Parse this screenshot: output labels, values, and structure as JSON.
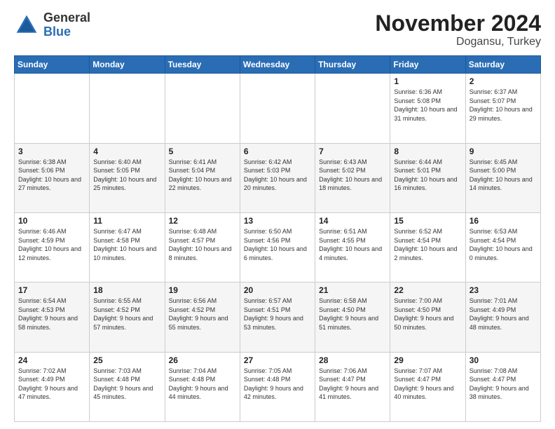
{
  "logo": {
    "general": "General",
    "blue": "Blue"
  },
  "title": "November 2024",
  "subtitle": "Dogansu, Turkey",
  "days_of_week": [
    "Sunday",
    "Monday",
    "Tuesday",
    "Wednesday",
    "Thursday",
    "Friday",
    "Saturday"
  ],
  "weeks": [
    [
      {
        "day": "",
        "info": ""
      },
      {
        "day": "",
        "info": ""
      },
      {
        "day": "",
        "info": ""
      },
      {
        "day": "",
        "info": ""
      },
      {
        "day": "",
        "info": ""
      },
      {
        "day": "1",
        "info": "Sunrise: 6:36 AM\nSunset: 5:08 PM\nDaylight: 10 hours and 31 minutes."
      },
      {
        "day": "2",
        "info": "Sunrise: 6:37 AM\nSunset: 5:07 PM\nDaylight: 10 hours and 29 minutes."
      }
    ],
    [
      {
        "day": "3",
        "info": "Sunrise: 6:38 AM\nSunset: 5:06 PM\nDaylight: 10 hours and 27 minutes."
      },
      {
        "day": "4",
        "info": "Sunrise: 6:40 AM\nSunset: 5:05 PM\nDaylight: 10 hours and 25 minutes."
      },
      {
        "day": "5",
        "info": "Sunrise: 6:41 AM\nSunset: 5:04 PM\nDaylight: 10 hours and 22 minutes."
      },
      {
        "day": "6",
        "info": "Sunrise: 6:42 AM\nSunset: 5:03 PM\nDaylight: 10 hours and 20 minutes."
      },
      {
        "day": "7",
        "info": "Sunrise: 6:43 AM\nSunset: 5:02 PM\nDaylight: 10 hours and 18 minutes."
      },
      {
        "day": "8",
        "info": "Sunrise: 6:44 AM\nSunset: 5:01 PM\nDaylight: 10 hours and 16 minutes."
      },
      {
        "day": "9",
        "info": "Sunrise: 6:45 AM\nSunset: 5:00 PM\nDaylight: 10 hours and 14 minutes."
      }
    ],
    [
      {
        "day": "10",
        "info": "Sunrise: 6:46 AM\nSunset: 4:59 PM\nDaylight: 10 hours and 12 minutes."
      },
      {
        "day": "11",
        "info": "Sunrise: 6:47 AM\nSunset: 4:58 PM\nDaylight: 10 hours and 10 minutes."
      },
      {
        "day": "12",
        "info": "Sunrise: 6:48 AM\nSunset: 4:57 PM\nDaylight: 10 hours and 8 minutes."
      },
      {
        "day": "13",
        "info": "Sunrise: 6:50 AM\nSunset: 4:56 PM\nDaylight: 10 hours and 6 minutes."
      },
      {
        "day": "14",
        "info": "Sunrise: 6:51 AM\nSunset: 4:55 PM\nDaylight: 10 hours and 4 minutes."
      },
      {
        "day": "15",
        "info": "Sunrise: 6:52 AM\nSunset: 4:54 PM\nDaylight: 10 hours and 2 minutes."
      },
      {
        "day": "16",
        "info": "Sunrise: 6:53 AM\nSunset: 4:54 PM\nDaylight: 10 hours and 0 minutes."
      }
    ],
    [
      {
        "day": "17",
        "info": "Sunrise: 6:54 AM\nSunset: 4:53 PM\nDaylight: 9 hours and 58 minutes."
      },
      {
        "day": "18",
        "info": "Sunrise: 6:55 AM\nSunset: 4:52 PM\nDaylight: 9 hours and 57 minutes."
      },
      {
        "day": "19",
        "info": "Sunrise: 6:56 AM\nSunset: 4:52 PM\nDaylight: 9 hours and 55 minutes."
      },
      {
        "day": "20",
        "info": "Sunrise: 6:57 AM\nSunset: 4:51 PM\nDaylight: 9 hours and 53 minutes."
      },
      {
        "day": "21",
        "info": "Sunrise: 6:58 AM\nSunset: 4:50 PM\nDaylight: 9 hours and 51 minutes."
      },
      {
        "day": "22",
        "info": "Sunrise: 7:00 AM\nSunset: 4:50 PM\nDaylight: 9 hours and 50 minutes."
      },
      {
        "day": "23",
        "info": "Sunrise: 7:01 AM\nSunset: 4:49 PM\nDaylight: 9 hours and 48 minutes."
      }
    ],
    [
      {
        "day": "24",
        "info": "Sunrise: 7:02 AM\nSunset: 4:49 PM\nDaylight: 9 hours and 47 minutes."
      },
      {
        "day": "25",
        "info": "Sunrise: 7:03 AM\nSunset: 4:48 PM\nDaylight: 9 hours and 45 minutes."
      },
      {
        "day": "26",
        "info": "Sunrise: 7:04 AM\nSunset: 4:48 PM\nDaylight: 9 hours and 44 minutes."
      },
      {
        "day": "27",
        "info": "Sunrise: 7:05 AM\nSunset: 4:48 PM\nDaylight: 9 hours and 42 minutes."
      },
      {
        "day": "28",
        "info": "Sunrise: 7:06 AM\nSunset: 4:47 PM\nDaylight: 9 hours and 41 minutes."
      },
      {
        "day": "29",
        "info": "Sunrise: 7:07 AM\nSunset: 4:47 PM\nDaylight: 9 hours and 40 minutes."
      },
      {
        "day": "30",
        "info": "Sunrise: 7:08 AM\nSunset: 4:47 PM\nDaylight: 9 hours and 38 minutes."
      }
    ]
  ]
}
